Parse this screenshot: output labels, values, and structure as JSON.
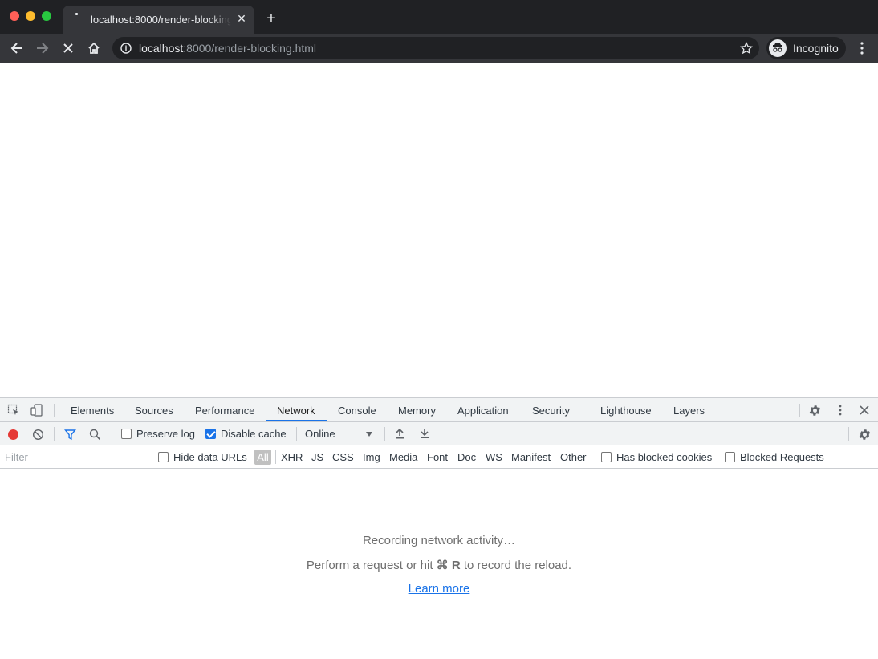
{
  "browser": {
    "tab_title": "localhost:8000/render-blocking.html",
    "url_host": "localhost",
    "url_path": ":8000/render-blocking.html",
    "profile_label": "Incognito"
  },
  "devtools": {
    "tabs": [
      "Elements",
      "Sources",
      "Performance",
      "Network",
      "Console",
      "Memory",
      "Application",
      "Security",
      "Lighthouse",
      "Layers"
    ],
    "active_tab": "Network",
    "toolbar": {
      "preserve_log_label": "Preserve log",
      "preserve_log_checked": false,
      "disable_cache_label": "Disable cache",
      "disable_cache_checked": true,
      "throttling_value": "Online"
    },
    "filterbar": {
      "filter_placeholder": "Filter",
      "hide_data_urls_label": "Hide data URLs",
      "types": [
        "All",
        "XHR",
        "JS",
        "CSS",
        "Img",
        "Media",
        "Font",
        "Doc",
        "WS",
        "Manifest",
        "Other"
      ],
      "has_blocked_cookies_label": "Has blocked cookies",
      "blocked_requests_label": "Blocked Requests"
    },
    "empty_state": {
      "title": "Recording network activity…",
      "hint_before": "Perform a request or hit ",
      "hint_key": "⌘ R",
      "hint_after": " to record the reload.",
      "learn_more": "Learn more"
    }
  },
  "colors": {
    "accent": "#1a73e8",
    "record": "#e53935",
    "chrome_dark": "#202124",
    "toolbar_dark": "#35363a"
  }
}
